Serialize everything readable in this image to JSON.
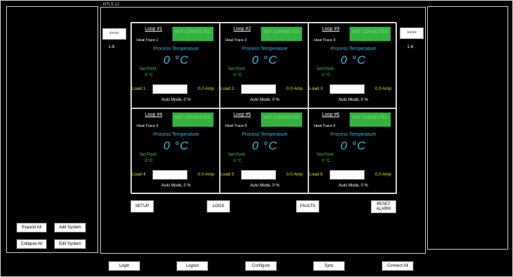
{
  "group_title": "HTLS 12",
  "nav": {
    "prev_label": "<<<<",
    "next_label": ">>>>",
    "left_range": "1-6",
    "right_range": "1-6"
  },
  "loops": [
    {
      "title": "Loop #1",
      "trace": "Heat Trace 1",
      "status": "NOT CONNECTED",
      "pt_label": "Process Temperature",
      "pt_value": "0 °C",
      "sp_label": "Set-Point",
      "sp_value": "0 °C",
      "load_label": "Load 1",
      "amp": "0.0 Amp",
      "auto": "Auto Mode, 0 %"
    },
    {
      "title": "Loop #2",
      "trace": "Heat Trace 2",
      "status": "NOT CONNECTED",
      "pt_label": "Process Temperature",
      "pt_value": "0 °C",
      "sp_label": "Set-Point",
      "sp_value": "0 °C",
      "load_label": "Load 2",
      "amp": "0.0 Amp",
      "auto": "Auto Mode, 0 %"
    },
    {
      "title": "Loop #3",
      "trace": "Heat Trace 3",
      "status": "NOT CONNECTED",
      "pt_label": "Process Temperature",
      "pt_value": "0 °C",
      "sp_label": "Set-Point",
      "sp_value": "0 °C",
      "load_label": "Load 3",
      "amp": "0.0 Amp",
      "auto": "Auto Mode, 0 %"
    },
    {
      "title": "Loop #4",
      "trace": "Heat Trace 4",
      "status": "NOT CONNECTED",
      "pt_label": "Process Temperature",
      "pt_value": "0 °C",
      "sp_label": "Set-Point",
      "sp_value": "0 °C",
      "load_label": "Load 4",
      "amp": "0.0 Amp",
      "auto": "Auto Mode, 0 %"
    },
    {
      "title": "Loop #5",
      "trace": "Heat Trace 5",
      "status": "NOT CONNECTED",
      "pt_label": "Process Temperature",
      "pt_value": "0 °C",
      "sp_label": "Set-Point",
      "sp_value": "0 °C",
      "load_label": "Load 5",
      "amp": "0.0 Amp",
      "auto": "Auto Mode, 0 %"
    },
    {
      "title": "Loop #6",
      "trace": "Heat Trace 6",
      "status": "NOT CONNECTED",
      "pt_label": "Process Temperature",
      "pt_value": "0 °C",
      "sp_label": "Set-Point",
      "sp_value": "0 °C",
      "load_label": "Load 6",
      "amp": "0.0 Amp",
      "auto": "Auto Mode, 0 %"
    }
  ],
  "actions": {
    "setup": "SETUP",
    "logs": "LOGS",
    "faults": "FAULTS",
    "reset_alarm": "RESET ALARM"
  },
  "left_buttons": {
    "expand_all": "Expand All",
    "add_system": "Add System",
    "collapse_all": "Collapse All",
    "edit_system": "Edit System"
  },
  "bottom_buttons": {
    "login": "Login",
    "logout": "Logout",
    "configure": "Configure",
    "sync": "Sync",
    "connect_all": "Connect All"
  },
  "colors": {
    "status_green": "#33b240",
    "temperature_blue": "#35b6e0",
    "setpoint_green": "#3dcc4a",
    "load_yellow": "#e6e300"
  }
}
